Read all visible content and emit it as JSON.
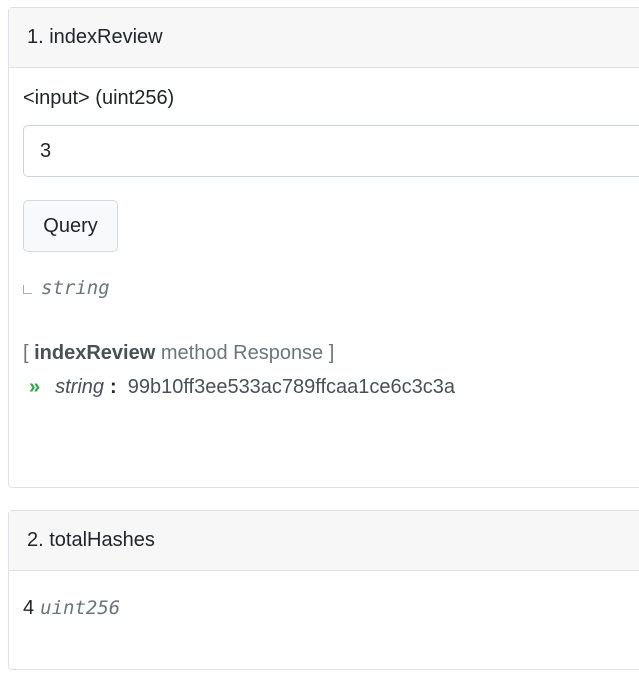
{
  "method1": {
    "title": "1. indexReview",
    "input_label": "<input> (uint256)",
    "input_value": "3",
    "query_label": "Query",
    "output_type": "string",
    "response": {
      "open_bracket": "[",
      "method_name": "indexReview",
      "suffix": "method Response ]",
      "arrow": "»",
      "type": "string",
      "colon": ":",
      "value": "99b10ff3ee533ac789ffcaa1ce6c3c3a"
    }
  },
  "method2": {
    "title": "2. totalHashes",
    "value": "4",
    "type": "uint256"
  }
}
